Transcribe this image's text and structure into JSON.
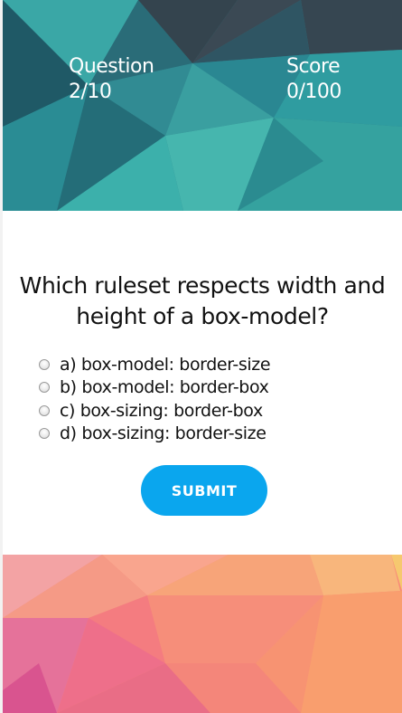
{
  "header": {
    "question_label": "Question",
    "question_value": "2/10",
    "score_label": "Score",
    "score_value": "0/100"
  },
  "quiz": {
    "question": "Which ruleset respects width and height of a box-model?",
    "options": [
      {
        "label": "a) box-model: border-size"
      },
      {
        "label": "b) box-model: border-box"
      },
      {
        "label": "c) box-sizing: border-box"
      },
      {
        "label": "d) box-sizing: border-size"
      }
    ],
    "submit_label": "SUBMIT"
  },
  "colors": {
    "top_banner": "#2f8f96",
    "bottom_banner": "#f78a76",
    "submit": "#0aa6ee"
  }
}
